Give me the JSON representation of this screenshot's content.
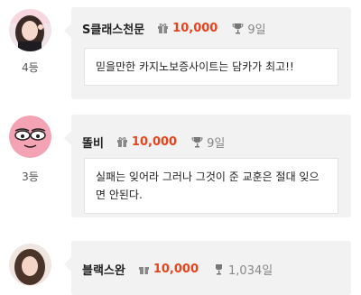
{
  "entries": [
    {
      "name": "S클래스천문",
      "points": "10,000",
      "days": "9일",
      "rank": "4등",
      "message": "믿을만한 카지노보증사이트는 담카가 최고!!",
      "avatar": "girl-photo"
    },
    {
      "name": "똘비",
      "points": "10,000",
      "days": "9일",
      "rank": "3등",
      "message": "실패는 잊어라 그러나 그것이 준 교훈은 절대 잊으면 안된다.",
      "avatar": "cartoon-face"
    },
    {
      "name": "블랙스완",
      "points": "10,000",
      "days": "1,034일",
      "rank": "",
      "message": "",
      "avatar": "girl-photo"
    }
  ],
  "colors": {
    "points": "#e8431c",
    "card": "#f2f2f2",
    "avatar_pink": "#f4a3b4"
  }
}
